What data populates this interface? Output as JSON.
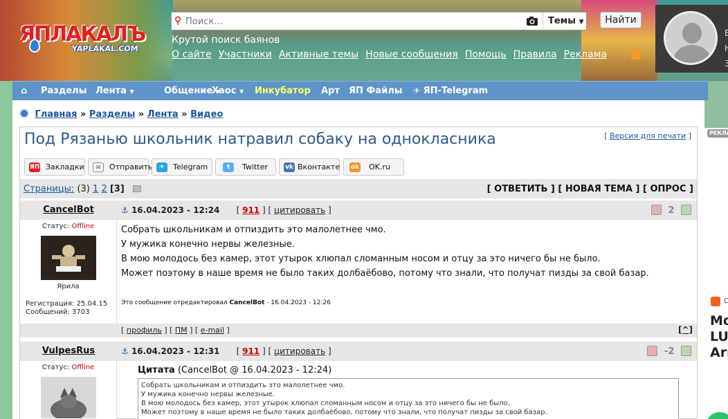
{
  "header": {
    "logo_text": "ЯПЛАКАЛЪ",
    "logo_sub": "YAPLAKAL.COM",
    "search_placeholder": "Поиск...",
    "search_scope": "Темы",
    "find_button": "Найти",
    "tagline": "Крутой поиск баянов",
    "links": [
      "О сайте",
      "Участники",
      "Активные темы",
      "Новые сообщения",
      "Помощь",
      "Правила",
      "Реклама"
    ],
    "userbox_side": [
      "B",
      "H",
      "3"
    ]
  },
  "nav": {
    "items": [
      "Разделы",
      "Лента",
      "Общение",
      "Хаос",
      "Инкубатор",
      "Арт",
      "ЯП Файлы",
      "ЯП-Telegram"
    ],
    "highlight_color": "#ffff66"
  },
  "breadcrumb": [
    "Главная",
    "Разделы",
    "Лента",
    "Видео"
  ],
  "topic": {
    "title": "Под Рязанью школьник натравил собаку на однокласника",
    "print_version": "Версия для печати"
  },
  "share": [
    "Закладки",
    "Отправить",
    "Telegram",
    "Twitter",
    "Вконтакте",
    "OK.ru"
  ],
  "pages": {
    "label": "Страницы:",
    "count": "(3)",
    "p1": "1",
    "p2": "2",
    "current": "[3]"
  },
  "actions": "[ ОТВЕТИТЬ ] [ НОВАЯ ТЕМА ] [ ОПРОС ]",
  "posts": [
    {
      "author": "CancelBot",
      "status_label": "Статус:",
      "status": "Offline",
      "caption": "Ярила",
      "reg": "Регистрация: 25.04.15",
      "messages": "Сообщений: 3703",
      "date": "16.04.2023 - 12:24",
      "num": "911",
      "cite": "цитировать",
      "rating": "2",
      "lines": [
        "Собрать школьникам и отпиздить это малолетнее чмо.",
        "У мужика конечно нервы железные.",
        "В мою молодось без камер, этот утырок хлюпал сломанным носом и отцу за это ничего бы не было.",
        "Может поэтому в наше время не было таких долбаёбово, потому что знали, что получат пизды за свой базар."
      ],
      "edit_prefix": "Это сообщение отредактировал",
      "edit_user": "CancelBot",
      "edit_date": "- 16.04.2023 - 12:26",
      "foot_profile": "профиль",
      "foot_pm": "ПМ",
      "foot_email": "e-mail",
      "foot_up": "[^]"
    },
    {
      "author": "VulpesRus",
      "status_label": "Статус:",
      "status": "Offline",
      "date": "16.04.2023 - 12:31",
      "num": "911",
      "cite": "цитировать",
      "rating": "-2",
      "quote_label": "Цитата",
      "quote_src": "(CancelBot @ 16.04.2023 - 12:24)",
      "quote_lines": [
        "Собрать школьникам и отпиздить это малолетнее чмо.",
        "У мужика конечно нервы железные.",
        "В мою молодось без камер, этот утырок хлюпал сломанным носом и отцу за это ничего бы не было.",
        "Может поэтому в наше время не было таких долбаёбово, потому что знали, что получат пизды за свой базар."
      ]
    }
  ],
  "ad": {
    "label": "РЕКЛА",
    "source": "С",
    "text": [
      "Мо",
      "LU",
      "Arr"
    ]
  }
}
